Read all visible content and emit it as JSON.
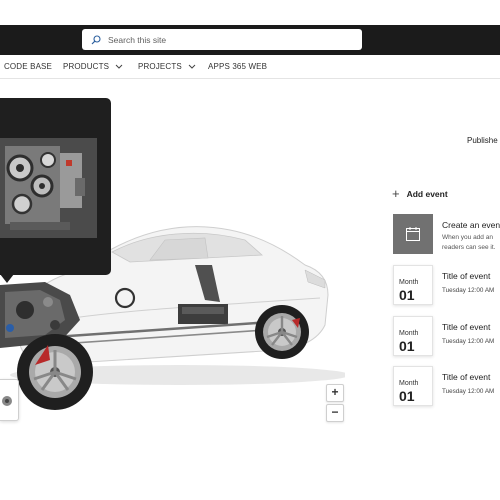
{
  "header": {
    "search_placeholder": "Search this site"
  },
  "nav": {
    "items": [
      {
        "label": "CODE BASE",
        "has_dropdown": false
      },
      {
        "label": "PRODUCTS",
        "has_dropdown": true
      },
      {
        "label": "PROJECTS",
        "has_dropdown": true
      },
      {
        "label": "APPS 365 WEB",
        "has_dropdown": false
      }
    ]
  },
  "news": {
    "published_label": "Publishe"
  },
  "viewer": {
    "zoom_in": "+",
    "zoom_out": "−"
  },
  "events": {
    "add_label": "Add event",
    "create": {
      "title": "Create an event",
      "desc_line1": "When you add an",
      "desc_line2": "readers can see it."
    },
    "items": [
      {
        "month": "Month",
        "day": "01",
        "title": "Title of event",
        "time": "Tuesday 12:00 AM"
      },
      {
        "month": "Month",
        "day": "01",
        "title": "Title of event",
        "time": "Tuesday 12:00 AM"
      },
      {
        "month": "Month",
        "day": "01",
        "title": "Title of event",
        "time": "Tuesday 12:00 AM"
      }
    ]
  },
  "colors": {
    "topbar": "#1b1b1b",
    "tile": "#717171",
    "popup": "#1f1f1f"
  }
}
